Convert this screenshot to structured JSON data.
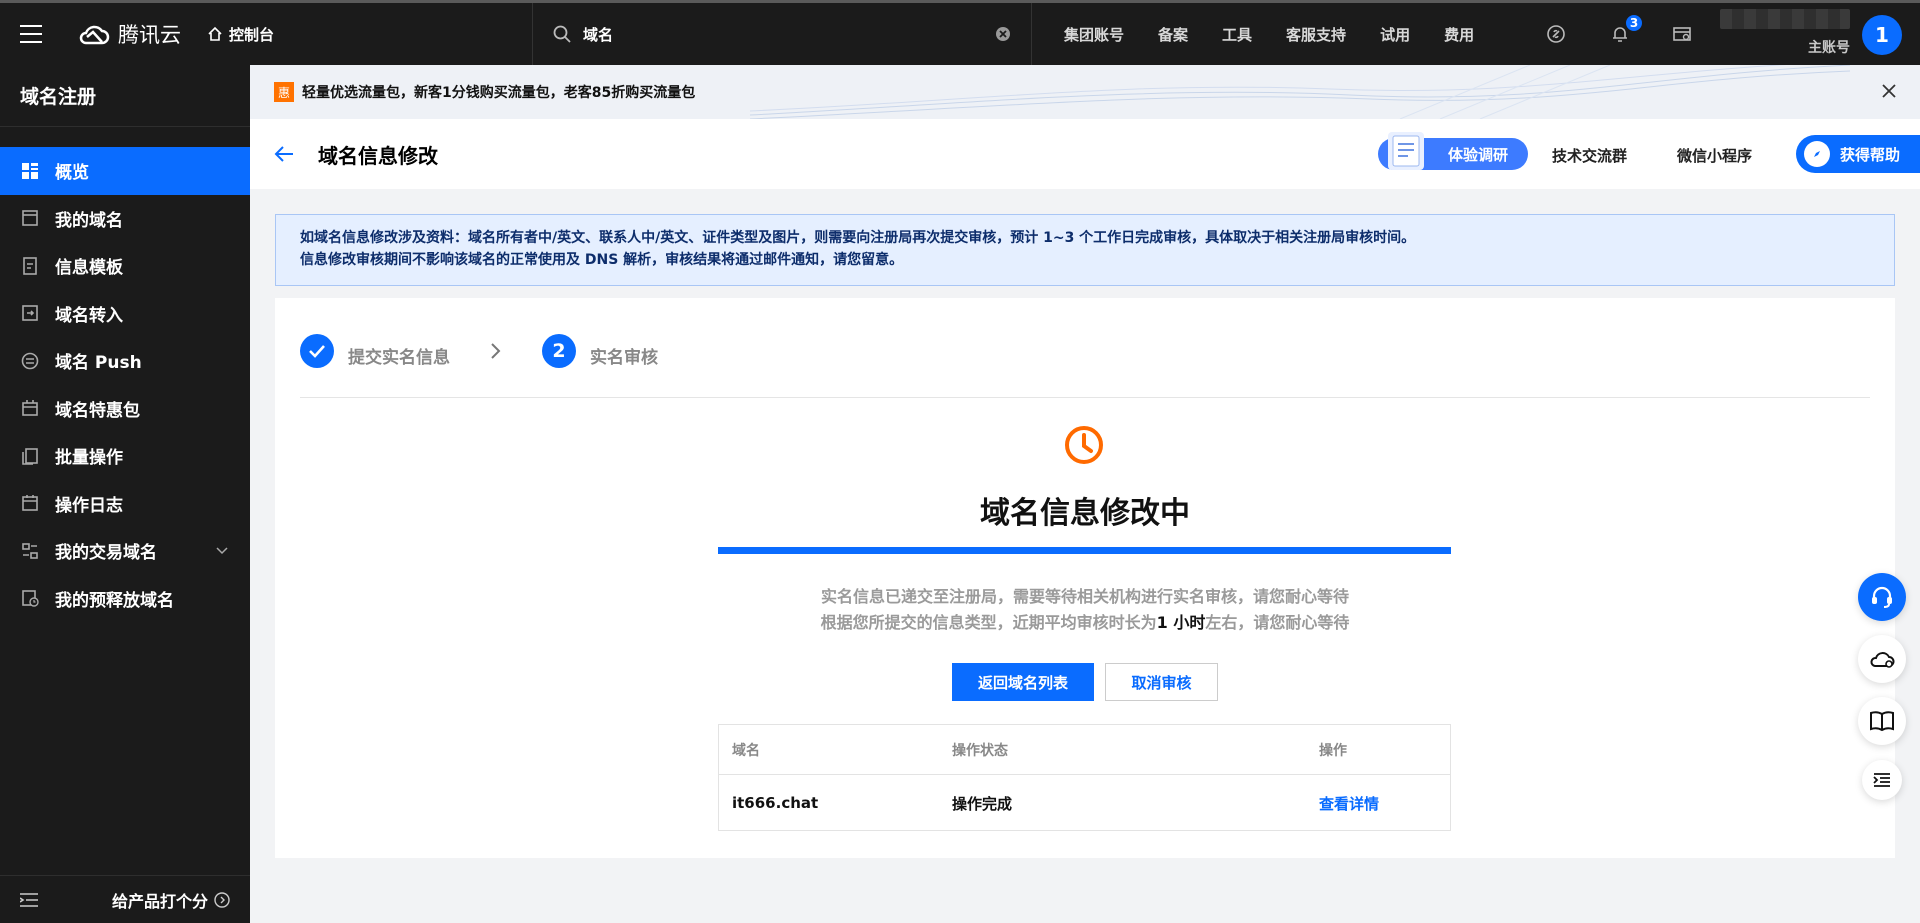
{
  "topbar": {
    "brand": "腾讯云",
    "console": "控制台",
    "search_value": "域名",
    "nav": [
      "集团账号",
      "备案",
      "工具",
      "客服支持",
      "试用",
      "费用"
    ],
    "notification_count": "3",
    "account_label": "主账号",
    "avatar": "1"
  },
  "sidebar": {
    "title": "域名注册",
    "items": [
      {
        "label": "概览",
        "icon": "grid-icon"
      },
      {
        "label": "我的域名",
        "icon": "window-icon"
      },
      {
        "label": "信息模板",
        "icon": "document-icon"
      },
      {
        "label": "域名转入",
        "icon": "transfer-icon"
      },
      {
        "label": "域名 Push",
        "icon": "push-icon"
      },
      {
        "label": "域名特惠包",
        "icon": "gift-icon"
      },
      {
        "label": "批量操作",
        "icon": "copy-icon"
      },
      {
        "label": "操作日志",
        "icon": "calendar-icon"
      },
      {
        "label": "我的交易域名",
        "icon": "trade-icon"
      },
      {
        "label": "我的预释放域名",
        "icon": "clock-box-icon"
      }
    ],
    "footer": "给产品打个分"
  },
  "banner": {
    "tag": "惠",
    "text": "轻量优选流量包，新客1分钱购买流量包，老客85折购买流量包"
  },
  "header": {
    "title": "域名信息修改",
    "survey": "体验调研",
    "links": [
      "技术交流群",
      "微信小程序"
    ],
    "help": "获得帮助"
  },
  "notice": {
    "line1": "如域名信息修改涉及资料：域名所有者中/英文、联系人中/英文、证件类型及图片，则需要向注册局再次提交审核，预计 1~3 个工作日完成审核，具体取决于相关注册局审核时间。",
    "line2": "信息修改审核期间不影响该域名的正常使用及 DNS 解析，审核结果将通过邮件通知，请您留意。"
  },
  "steps": [
    {
      "label": "提交实名信息",
      "state": "done"
    },
    {
      "label": "实名审核",
      "num": "2",
      "state": "current"
    }
  ],
  "status": {
    "title": "域名信息修改中",
    "progress": 1.0,
    "line1": "实名信息已递交至注册局，需要等待相关机构进行实名审核，请您耐心等待",
    "line2_pre": "根据您所提交的信息类型，近期平均审核时长为",
    "line2_bold": "1 小时",
    "line2_post": "左右，请您耐心等待"
  },
  "buttons": {
    "primary": "返回域名列表",
    "secondary": "取消审核"
  },
  "table": {
    "headers": [
      "域名",
      "操作状态",
      "操作"
    ],
    "rows": [
      {
        "domain": "it666.chat",
        "status": "操作完成",
        "action": "查看详情"
      }
    ]
  },
  "colors": {
    "brand": "#0a6cff",
    "clock": "#ff6a00",
    "tag": "#ff7200"
  }
}
